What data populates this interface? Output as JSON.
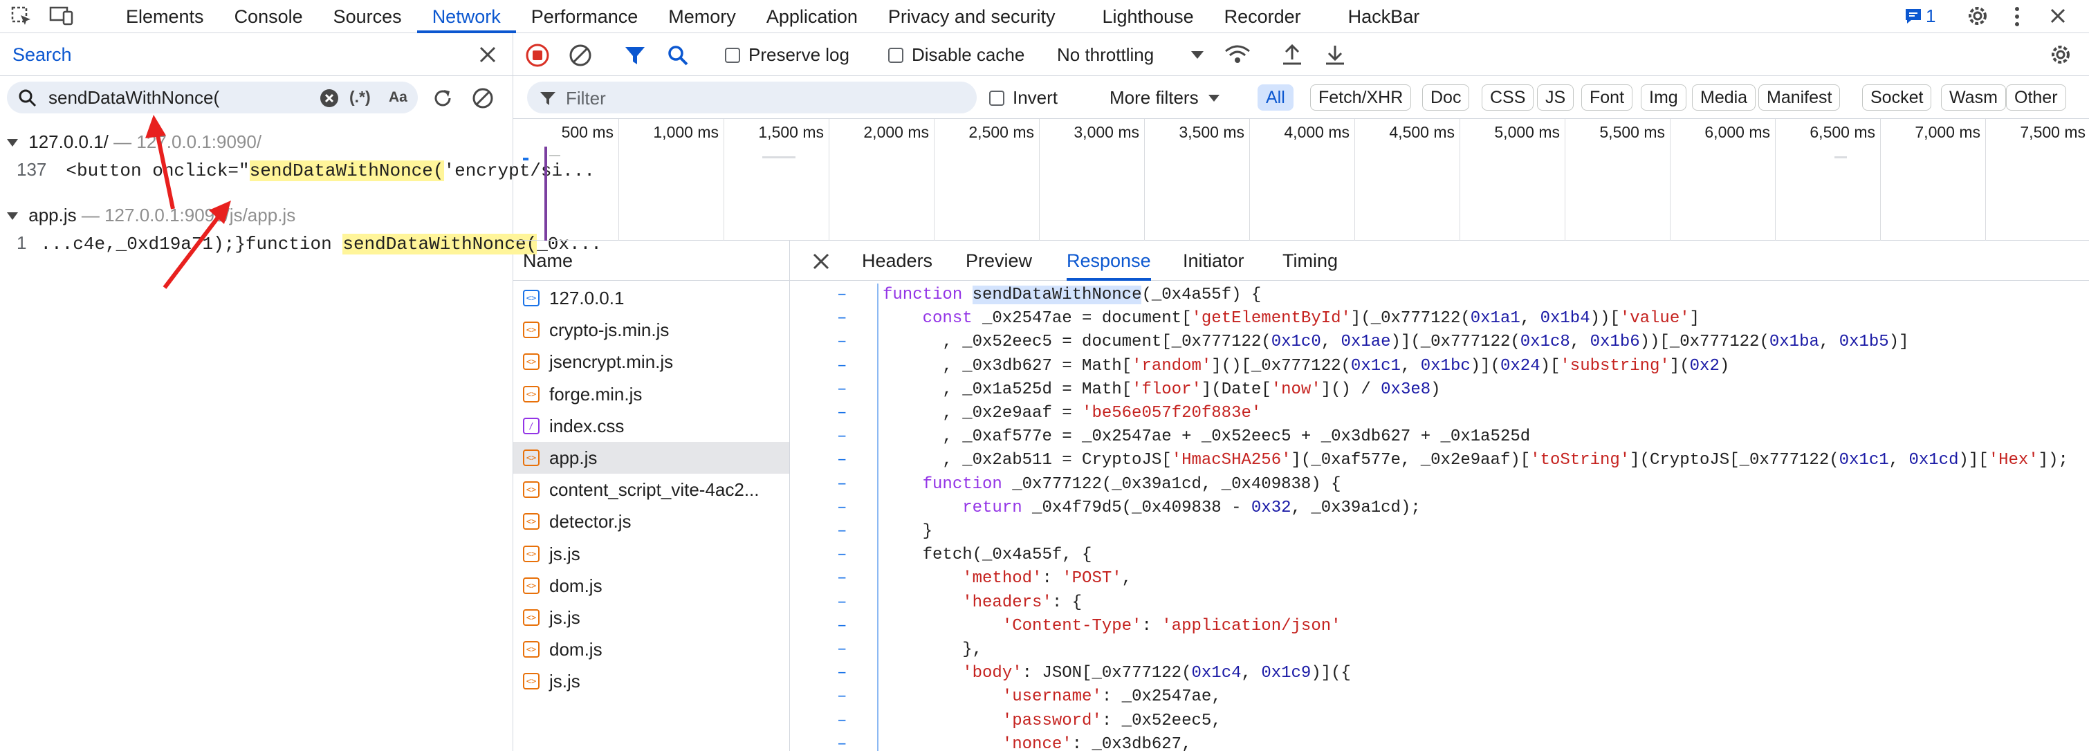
{
  "tabs": [
    "Elements",
    "Console",
    "Sources",
    "Network",
    "Performance",
    "Memory",
    "Application",
    "Privacy and security",
    "Lighthouse",
    "Recorder",
    "HackBar"
  ],
  "active_tab": "Network",
  "issues_count": "1",
  "search": {
    "title": "Search",
    "query": "sendDataWithNonce(",
    "regex_label": "(.*)",
    "case_label": "Aa",
    "results": [
      {
        "file": "127.0.0.1/",
        "url": "127.0.0.1:9090/",
        "line": "137",
        "pre": "<button onclick=\"",
        "match": "sendDataWithNonce(",
        "post": "'encrypt/si..."
      },
      {
        "file": "app.js",
        "url": "127.0.0.1:9090/js/app.js",
        "line": "1",
        "pre": "...c4e,_0xd19a71);}function ",
        "match": "sendDataWithNonce(",
        "post": "_0x..."
      }
    ]
  },
  "toolbar": {
    "preserve_log": "Preserve log",
    "disable_cache": "Disable cache",
    "throttling": "No throttling",
    "filter_placeholder": "Filter",
    "invert": "Invert",
    "more_filters": "More filters",
    "types": [
      "All",
      "Fetch/XHR",
      "Doc",
      "CSS",
      "JS",
      "Font",
      "Img",
      "Media",
      "Manifest",
      "Socket",
      "Wasm",
      "Other"
    ]
  },
  "timeline_ticks": [
    "500 ms",
    "1,000 ms",
    "1,500 ms",
    "2,000 ms",
    "2,500 ms",
    "3,000 ms",
    "3,500 ms",
    "4,000 ms",
    "4,500 ms",
    "5,000 ms",
    "5,500 ms",
    "6,000 ms",
    "6,500 ms",
    "7,000 ms",
    "7,500 ms"
  ],
  "requests": {
    "header": "Name",
    "items": [
      {
        "name": "127.0.0.1",
        "type": "doc"
      },
      {
        "name": "crypto-js.min.js",
        "type": "js"
      },
      {
        "name": "jsencrypt.min.js",
        "type": "js"
      },
      {
        "name": "forge.min.js",
        "type": "js"
      },
      {
        "name": "index.css",
        "type": "css"
      },
      {
        "name": "app.js",
        "type": "js",
        "selected": true
      },
      {
        "name": "content_script_vite-4ac2...",
        "type": "js"
      },
      {
        "name": "detector.js",
        "type": "js"
      },
      {
        "name": "js.js",
        "type": "js"
      },
      {
        "name": "dom.js",
        "type": "js"
      },
      {
        "name": "js.js",
        "type": "js"
      },
      {
        "name": "dom.js",
        "type": "js"
      },
      {
        "name": "js.js",
        "type": "js"
      }
    ]
  },
  "detail_tabs": [
    "Headers",
    "Preview",
    "Response",
    "Initiator",
    "Timing"
  ],
  "active_detail_tab": "Response",
  "code_lines": [
    "function sendDataWithNonce(_0x4a55f) {",
    "    const _0x2547ae = document['getElementById'](_0x777122(0x1a1, 0x1b4))['value']",
    "      , _0x52eec5 = document[_0x777122(0x1c0, 0x1ae)](_0x777122(0x1c8, 0x1b6))[_0x777122(0x1ba, 0x1b5)]",
    "      , _0x3db627 = Math['random']()[_0x777122(0x1c1, 0x1bc)](0x24)['substring'](0x2)",
    "      , _0x1a525d = Math['floor'](Date['now']() / 0x3e8)",
    "      , _0x2e9aaf = 'be56e057f20f883e'",
    "      , _0xaf577e = _0x2547ae + _0x52eec5 + _0x3db627 + _0x1a525d",
    "      , _0x2ab511 = CryptoJS['HmacSHA256'](_0xaf577e, _0x2e9aaf)['toString'](CryptoJS[_0x777122(0x1c1, 0x1cd)]['Hex']);",
    "    function _0x777122(_0x39a1cd, _0x409838) {",
    "        return _0x4f79d5(_0x409838 - 0x32, _0x39a1cd);",
    "    }",
    "    fetch(_0x4a55f, {",
    "        'method': 'POST',",
    "        'headers': {",
    "            'Content-Type': 'application/json'",
    "        },",
    "        'body': JSON[_0x777122(0x1c4, 0x1c9)]({",
    "            'username': _0x2547ae,",
    "            'password': _0x52eec5,",
    "            'nonce': _0x3db627,"
  ],
  "colors": {
    "accent": "#0b57d0",
    "record": "#d93025",
    "highlight": "#fff59a",
    "annotation": "#e8201e"
  },
  "icons": [
    "inspect-icon",
    "device-toggle-icon",
    "issues-icon",
    "settings-icon",
    "more-icon",
    "close-icon",
    "search-icon",
    "clear-icon",
    "refresh-icon",
    "record-icon",
    "clear-log-icon",
    "filter-icon",
    "network-conditions-icon",
    "upload-icon",
    "download-icon",
    "file-icon",
    "annotation-arrow-icon"
  ]
}
